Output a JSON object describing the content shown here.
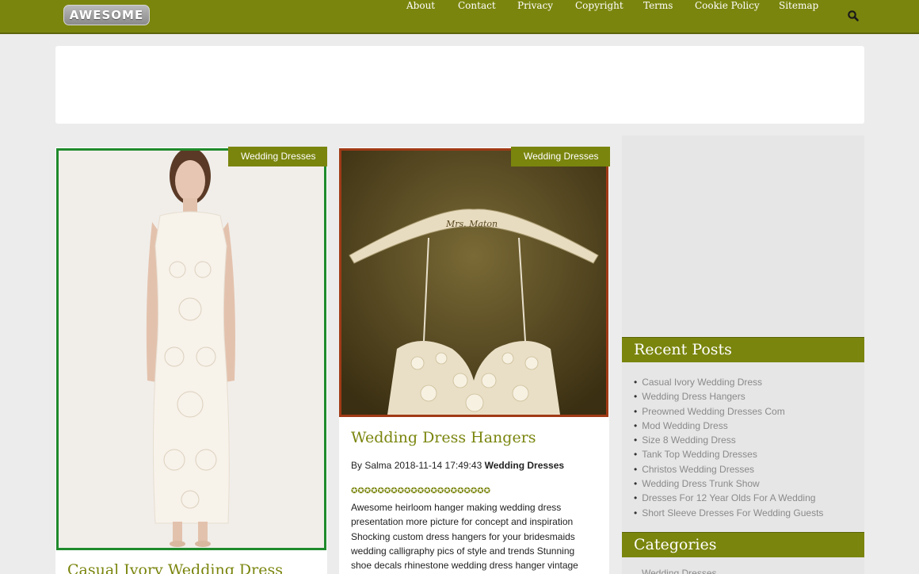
{
  "header": {
    "logo_text": "AWESOME",
    "nav": [
      "About",
      "Contact",
      "Privacy",
      "Copyright",
      "Terms",
      "Cookie Policy",
      "Sitemap"
    ],
    "search_icon": "search-icon",
    "bar_color": "#7a850d"
  },
  "posts": [
    {
      "category": "Wedding Dresses",
      "title": "Casual Ivory Wedding Dress",
      "image_alt": "ivory lace sheath wedding dress"
    },
    {
      "category": "Wedding Dresses",
      "title": "Wedding Dress Hangers",
      "author_prefix": "By Salma",
      "date": "2018-11-14 17:49:43",
      "meta_category": "Wedding Dresses",
      "rating_stars": "✪✪✪✪✪✪✪✪✪✪✪✪✪✪✪✪✪✪✪✪✪",
      "excerpt": "Awesome heirloom hanger making wedding dress presentation more picture for concept and inspiration Shocking custom dress hangers for your bridesmaids wedding calligraphy pics of style and trends Stunning shoe decals rhinestone wedding dress hanger vintage",
      "hanger_text": "Mrs. Maton"
    }
  ],
  "sidebar": {
    "recent_title": "Recent Posts",
    "recent_posts": [
      "Casual Ivory Wedding Dress",
      "Wedding Dress Hangers",
      "Preowned Wedding Dresses Com",
      "Mod Wedding Dress",
      "Size 8 Wedding Dress",
      "Tank Top Wedding Dresses",
      "Christos Wedding Dresses",
      "Wedding Dress Trunk Show",
      "Dresses For 12 Year Olds For A Wedding",
      "Short Sleeve Dresses For Wedding Guests"
    ],
    "categories_title": "Categories",
    "categories": [
      "Wedding Dresses"
    ]
  }
}
